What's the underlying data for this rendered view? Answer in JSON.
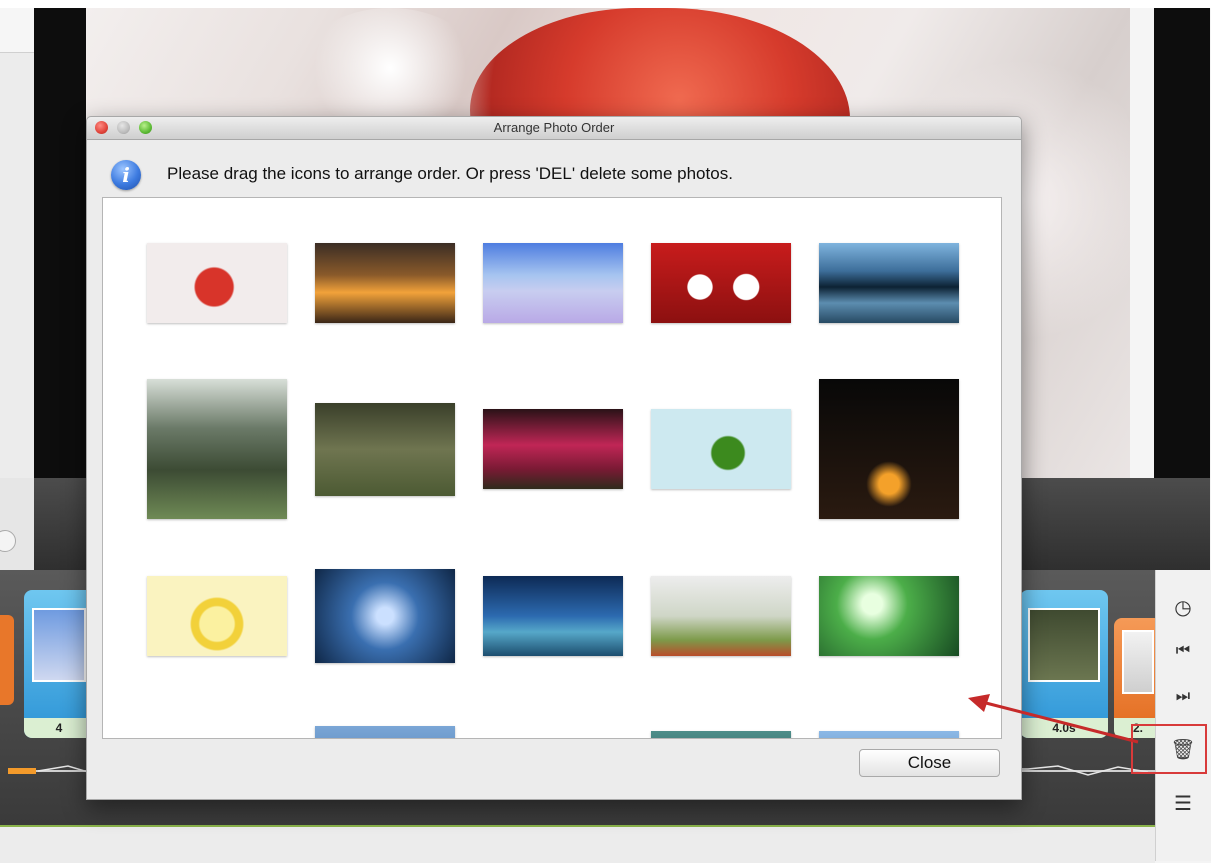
{
  "dialog": {
    "title": "Arrange Photo Order",
    "info_message": "Please drag the icons to arrange order. Or press 'DEL' delete some photos.",
    "close_label": "Close"
  },
  "photos": [
    {
      "name": "apple-splash",
      "bg": "radial-gradient(circle at 48% 55%,#d8342a 0 22%,#f2ecec 24% 100%)"
    },
    {
      "name": "palm-sunset",
      "bg": "linear-gradient(#3b2d25 0%,#8a5a2a 40%,#f2a23a 62%,#3a2617 100%)"
    },
    {
      "name": "beach-starfish",
      "bg": "linear-gradient(#4e7de0 0%,#a6c4f0 40%,#c8cdf0 60%,#b9a9e6 100%)"
    },
    {
      "name": "puppies-christmas",
      "bg": "radial-gradient(circle at 35% 55%,#ffffff 0 12%,rgba(0,0,0,0) 13%),radial-gradient(circle at 68% 55%,#ffffff 0 12%,rgba(0,0,0,0) 13%),linear-gradient(#c81c1c,#8c1010)"
    },
    {
      "name": "mountain-lake",
      "bg": "linear-gradient(#7fb4de 0%,#3d6e9a 35%,#0c2233 55%,#5c8db0 75%,#274a63 100%)"
    },
    {
      "name": "forest-path",
      "bg": "linear-gradient(#d8dfd8 0%,#6b7a68 35%,#3c4b34 65%,#6f8a55 100%)"
    },
    {
      "name": "couple-grass",
      "bg": "linear-gradient(#3a3f2a 0%,#6f7550 50%,#4c5a33 100%)"
    },
    {
      "name": "pink-trees",
      "bg": "linear-gradient(#2a1217 0%,#c02656 45%,#7a1a34 75%,#2f2a1c 100%)"
    },
    {
      "name": "kiwi-splash",
      "bg": "radial-gradient(circle at 55% 55%,#3c8a1e 0 18%,#cde9f0 20% 100%)"
    },
    {
      "name": "campfire-night",
      "bg": "radial-gradient(circle at 50% 75%,#f4a12a 0 8%,rgba(0,0,0,0) 18%),linear-gradient(#080808,#2a1a10)"
    },
    {
      "name": "lemon-slices",
      "bg": "radial-gradient(circle at 50% 60%,#fbf1a0 0 20%,#f2d13a 22% 30%,#faf3c0 32% 100%)"
    },
    {
      "name": "trees-sky",
      "bg": "radial-gradient(circle at 50% 50%,#cbe0ff 0 10%,#3a6fb0 40%,#0f2747 100%)"
    },
    {
      "name": "tropical-palm",
      "bg": "linear-gradient(#0d2a55 0%,#2c6ab0 50%,#56a8c9 70%,#1c4d6e 100%)"
    },
    {
      "name": "fruit-splash",
      "bg": "linear-gradient(#ededed 0%,#cfd6c7 50%,#7d9a4a 80%,#b94d2a 100%)"
    },
    {
      "name": "green-sunlight",
      "bg": "radial-gradient(circle at 38% 35%,#e8ffe0 0 10%,#4cae49 35%,#174a22 100%)"
    },
    {
      "name": "partial-1",
      "bg": "linear-gradient(#7aa6d6,#5b88bd)"
    },
    {
      "name": "partial-2",
      "bg": "linear-gradient(#4e8e8a,#2e6460)"
    },
    {
      "name": "partial-3",
      "bg": "linear-gradient(#8cb9e6,#5e8fc4)"
    }
  ],
  "timeline": {
    "clips": [
      {
        "label": "4",
        "color": "blue"
      },
      {
        "label": "4.0s",
        "color": "blue"
      },
      {
        "label": "2.",
        "color": "orange"
      }
    ]
  },
  "side_toolbar": [
    {
      "name": "clock-icon",
      "glyph": "◷"
    },
    {
      "name": "skip-back-icon",
      "glyph": "⏮"
    },
    {
      "name": "skip-forward-icon",
      "glyph": "⏭"
    },
    {
      "name": "trash-icon",
      "glyph": "🗑"
    },
    {
      "name": "list-icon",
      "glyph": "☰"
    }
  ],
  "colors": {
    "accent_blue": "#3d7be0",
    "highlight_red": "#d83a3a",
    "timeline_label_bg": "#dbefd2"
  }
}
